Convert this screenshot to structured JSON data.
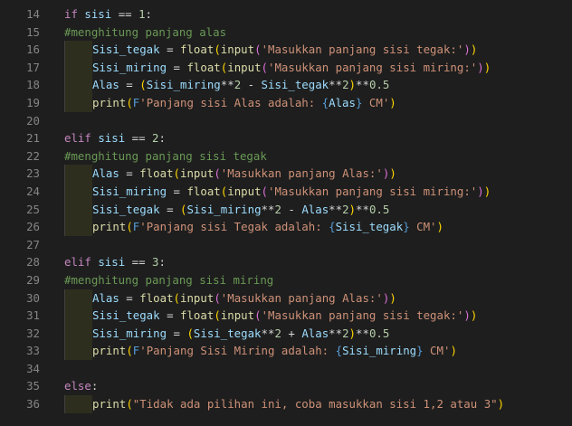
{
  "colors": {
    "background": "#1e1e1e",
    "line_number": "#858585",
    "keyword": "#c586c0",
    "variable": "#9cdcfe",
    "function": "#dcdcaa",
    "string": "#ce9178",
    "number": "#b5cea8",
    "comment": "#6a9955",
    "operator": "#d4d4d4",
    "fstring_prefix": "#569cd6",
    "bracket_1": "#ffd700",
    "bracket_2": "#da70d6",
    "bracket_3": "#179fff",
    "indent_guide": "#2e2e1f"
  },
  "lines": [
    {
      "num": "14",
      "indent": 0,
      "tokens": [
        {
          "t": "kw",
          "v": "if "
        },
        {
          "t": "var",
          "v": "sisi"
        },
        {
          "t": "op",
          "v": " == "
        },
        {
          "t": "num",
          "v": "1"
        },
        {
          "t": "op",
          "v": ":"
        }
      ]
    },
    {
      "num": "15",
      "indent": 0,
      "tokens": [
        {
          "t": "cmt",
          "v": "#menghitung panjang alas"
        }
      ]
    },
    {
      "num": "16",
      "indent": 1,
      "tokens": [
        {
          "t": "var",
          "v": "Sisi_tegak"
        },
        {
          "t": "op",
          "v": " = "
        },
        {
          "t": "fn",
          "v": "float"
        },
        {
          "t": "brk1",
          "v": "("
        },
        {
          "t": "fn",
          "v": "input"
        },
        {
          "t": "brk2",
          "v": "("
        },
        {
          "t": "str",
          "v": "'Masukkan panjang sisi tegak:'"
        },
        {
          "t": "brk2",
          "v": ")"
        },
        {
          "t": "brk1",
          "v": ")"
        }
      ]
    },
    {
      "num": "17",
      "indent": 1,
      "tokens": [
        {
          "t": "var",
          "v": "Sisi_miring"
        },
        {
          "t": "op",
          "v": " = "
        },
        {
          "t": "fn",
          "v": "float"
        },
        {
          "t": "brk1",
          "v": "("
        },
        {
          "t": "fn",
          "v": "input"
        },
        {
          "t": "brk2",
          "v": "("
        },
        {
          "t": "str",
          "v": "'Masukkan panjang sisi miring:'"
        },
        {
          "t": "brk2",
          "v": ")"
        },
        {
          "t": "brk1",
          "v": ")"
        }
      ]
    },
    {
      "num": "18",
      "indent": 1,
      "tokens": [
        {
          "t": "var",
          "v": "Alas"
        },
        {
          "t": "op",
          "v": " = "
        },
        {
          "t": "brk1",
          "v": "("
        },
        {
          "t": "var",
          "v": "Sisi_miring"
        },
        {
          "t": "op",
          "v": "**"
        },
        {
          "t": "num",
          "v": "2"
        },
        {
          "t": "op",
          "v": " - "
        },
        {
          "t": "var",
          "v": "Sisi_tegak"
        },
        {
          "t": "op",
          "v": "**"
        },
        {
          "t": "num",
          "v": "2"
        },
        {
          "t": "brk1",
          "v": ")"
        },
        {
          "t": "op",
          "v": "**"
        },
        {
          "t": "num",
          "v": "0.5"
        }
      ]
    },
    {
      "num": "19",
      "indent": 1,
      "tokens": [
        {
          "t": "fn",
          "v": "print"
        },
        {
          "t": "brk1",
          "v": "("
        },
        {
          "t": "fp",
          "v": "F"
        },
        {
          "t": "str",
          "v": "'Panjang sisi Alas adalah: "
        },
        {
          "t": "fp",
          "v": "{"
        },
        {
          "t": "var",
          "v": "Alas"
        },
        {
          "t": "fp",
          "v": "}"
        },
        {
          "t": "str",
          "v": " CM'"
        },
        {
          "t": "brk1",
          "v": ")"
        }
      ]
    },
    {
      "num": "20",
      "indent": 0,
      "tokens": []
    },
    {
      "num": "21",
      "indent": 0,
      "tokens": [
        {
          "t": "kw",
          "v": "elif "
        },
        {
          "t": "var",
          "v": "sisi"
        },
        {
          "t": "op",
          "v": " == "
        },
        {
          "t": "num",
          "v": "2"
        },
        {
          "t": "op",
          "v": ":"
        }
      ]
    },
    {
      "num": "22",
      "indent": 0,
      "tokens": [
        {
          "t": "cmt",
          "v": "#menghitung panjang sisi tegak"
        }
      ]
    },
    {
      "num": "23",
      "indent": 1,
      "tokens": [
        {
          "t": "var",
          "v": "Alas"
        },
        {
          "t": "op",
          "v": " = "
        },
        {
          "t": "fn",
          "v": "float"
        },
        {
          "t": "brk1",
          "v": "("
        },
        {
          "t": "fn",
          "v": "input"
        },
        {
          "t": "brk2",
          "v": "("
        },
        {
          "t": "str",
          "v": "'Masukkan panjang Alas:'"
        },
        {
          "t": "brk2",
          "v": ")"
        },
        {
          "t": "brk1",
          "v": ")"
        }
      ]
    },
    {
      "num": "24",
      "indent": 1,
      "tokens": [
        {
          "t": "var",
          "v": "Sisi_miring"
        },
        {
          "t": "op",
          "v": " = "
        },
        {
          "t": "fn",
          "v": "float"
        },
        {
          "t": "brk1",
          "v": "("
        },
        {
          "t": "fn",
          "v": "input"
        },
        {
          "t": "brk2",
          "v": "("
        },
        {
          "t": "str",
          "v": "'Masukkan panjang sisi miring:'"
        },
        {
          "t": "brk2",
          "v": ")"
        },
        {
          "t": "brk1",
          "v": ")"
        }
      ]
    },
    {
      "num": "25",
      "indent": 1,
      "tokens": [
        {
          "t": "var",
          "v": "Sisi_tegak"
        },
        {
          "t": "op",
          "v": " = "
        },
        {
          "t": "brk1",
          "v": "("
        },
        {
          "t": "var",
          "v": "Sisi_miring"
        },
        {
          "t": "op",
          "v": "**"
        },
        {
          "t": "num",
          "v": "2"
        },
        {
          "t": "op",
          "v": " - "
        },
        {
          "t": "var",
          "v": "Alas"
        },
        {
          "t": "op",
          "v": "**"
        },
        {
          "t": "num",
          "v": "2"
        },
        {
          "t": "brk1",
          "v": ")"
        },
        {
          "t": "op",
          "v": "**"
        },
        {
          "t": "num",
          "v": "0.5"
        }
      ]
    },
    {
      "num": "26",
      "indent": 1,
      "tokens": [
        {
          "t": "fn",
          "v": "print"
        },
        {
          "t": "brk1",
          "v": "("
        },
        {
          "t": "fp",
          "v": "F"
        },
        {
          "t": "str",
          "v": "'Panjang sisi Tegak adalah: "
        },
        {
          "t": "fp",
          "v": "{"
        },
        {
          "t": "var",
          "v": "Sisi_tegak"
        },
        {
          "t": "fp",
          "v": "}"
        },
        {
          "t": "str",
          "v": " CM'"
        },
        {
          "t": "brk1",
          "v": ")"
        }
      ]
    },
    {
      "num": "27",
      "indent": 0,
      "tokens": []
    },
    {
      "num": "28",
      "indent": 0,
      "tokens": [
        {
          "t": "kw",
          "v": "elif "
        },
        {
          "t": "var",
          "v": "sisi"
        },
        {
          "t": "op",
          "v": " == "
        },
        {
          "t": "num",
          "v": "3"
        },
        {
          "t": "op",
          "v": ":"
        }
      ]
    },
    {
      "num": "29",
      "indent": 0,
      "tokens": [
        {
          "t": "cmt",
          "v": "#menghitung panjang sisi miring"
        }
      ]
    },
    {
      "num": "30",
      "indent": 1,
      "tokens": [
        {
          "t": "var",
          "v": "Alas"
        },
        {
          "t": "op",
          "v": " = "
        },
        {
          "t": "fn",
          "v": "float"
        },
        {
          "t": "brk1",
          "v": "("
        },
        {
          "t": "fn",
          "v": "input"
        },
        {
          "t": "brk2",
          "v": "("
        },
        {
          "t": "str",
          "v": "'Masukkan panjang Alas:'"
        },
        {
          "t": "brk2",
          "v": ")"
        },
        {
          "t": "brk1",
          "v": ")"
        }
      ]
    },
    {
      "num": "31",
      "indent": 1,
      "tokens": [
        {
          "t": "var",
          "v": "Sisi_tegak"
        },
        {
          "t": "op",
          "v": " = "
        },
        {
          "t": "fn",
          "v": "float"
        },
        {
          "t": "brk1",
          "v": "("
        },
        {
          "t": "fn",
          "v": "input"
        },
        {
          "t": "brk2",
          "v": "("
        },
        {
          "t": "str",
          "v": "'Masukkan panjang sisi tegak:'"
        },
        {
          "t": "brk2",
          "v": ")"
        },
        {
          "t": "brk1",
          "v": ")"
        }
      ]
    },
    {
      "num": "32",
      "indent": 1,
      "tokens": [
        {
          "t": "var",
          "v": "Sisi_miring"
        },
        {
          "t": "op",
          "v": " = "
        },
        {
          "t": "brk1",
          "v": "("
        },
        {
          "t": "var",
          "v": "Sisi_tegak"
        },
        {
          "t": "op",
          "v": "**"
        },
        {
          "t": "num",
          "v": "2"
        },
        {
          "t": "op",
          "v": " + "
        },
        {
          "t": "var",
          "v": "Alas"
        },
        {
          "t": "op",
          "v": "**"
        },
        {
          "t": "num",
          "v": "2"
        },
        {
          "t": "brk1",
          "v": ")"
        },
        {
          "t": "op",
          "v": "**"
        },
        {
          "t": "num",
          "v": "0.5"
        }
      ]
    },
    {
      "num": "33",
      "indent": 1,
      "tokens": [
        {
          "t": "fn",
          "v": "print"
        },
        {
          "t": "brk1",
          "v": "("
        },
        {
          "t": "fp",
          "v": "F"
        },
        {
          "t": "str",
          "v": "'Panjang Sisi Miring adalah: "
        },
        {
          "t": "fp",
          "v": "{"
        },
        {
          "t": "var",
          "v": "Sisi_miring"
        },
        {
          "t": "fp",
          "v": "}"
        },
        {
          "t": "str",
          "v": " CM'"
        },
        {
          "t": "brk1",
          "v": ")"
        }
      ]
    },
    {
      "num": "34",
      "indent": 0,
      "tokens": []
    },
    {
      "num": "35",
      "indent": 0,
      "tokens": [
        {
          "t": "kw",
          "v": "else"
        },
        {
          "t": "op",
          "v": ":"
        }
      ]
    },
    {
      "num": "36",
      "indent": 1,
      "tokens": [
        {
          "t": "fn",
          "v": "print"
        },
        {
          "t": "brk1",
          "v": "("
        },
        {
          "t": "str",
          "v": "\"Tidak ada pilihan ini, coba masukkan sisi 1,2 atau 3\""
        },
        {
          "t": "brk1",
          "v": ")"
        }
      ]
    }
  ]
}
